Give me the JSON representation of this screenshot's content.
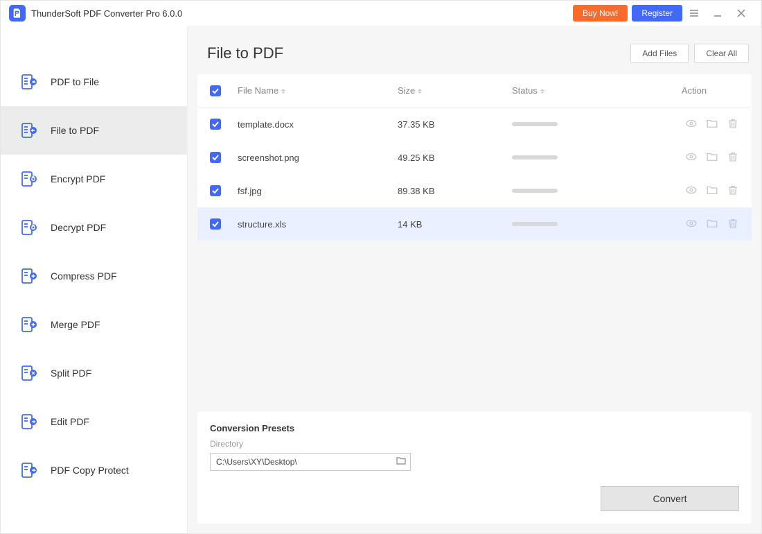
{
  "app": {
    "title": "ThunderSoft PDF Converter Pro 6.0.0"
  },
  "titlebar": {
    "buy": "Buy Now!",
    "register": "Register"
  },
  "sidebar": {
    "items": [
      {
        "label": "PDF to File"
      },
      {
        "label": "File to PDF"
      },
      {
        "label": "Encrypt PDF"
      },
      {
        "label": "Decrypt PDF"
      },
      {
        "label": "Compress PDF"
      },
      {
        "label": "Merge PDF"
      },
      {
        "label": "Split PDF"
      },
      {
        "label": "Edit PDF"
      },
      {
        "label": "PDF Copy Protect"
      }
    ],
    "active_index": 1
  },
  "page": {
    "title": "File to PDF",
    "add_files": "Add Files",
    "clear_all": "Clear All",
    "columns": {
      "name": "File Name",
      "size": "Size",
      "status": "Status",
      "action": "Action"
    },
    "files": [
      {
        "name": "template.docx",
        "size": "37.35 KB",
        "checked": true,
        "selected": false
      },
      {
        "name": "screenshot.png",
        "size": "49.25 KB",
        "checked": true,
        "selected": false
      },
      {
        "name": "fsf.jpg",
        "size": "89.38 KB",
        "checked": true,
        "selected": false
      },
      {
        "name": "structure.xls",
        "size": "14 KB",
        "checked": true,
        "selected": true
      }
    ]
  },
  "presets": {
    "title": "Conversion Presets",
    "directory_label": "Directory",
    "directory_value": "C:\\Users\\XY\\Desktop\\",
    "convert": "Convert"
  }
}
